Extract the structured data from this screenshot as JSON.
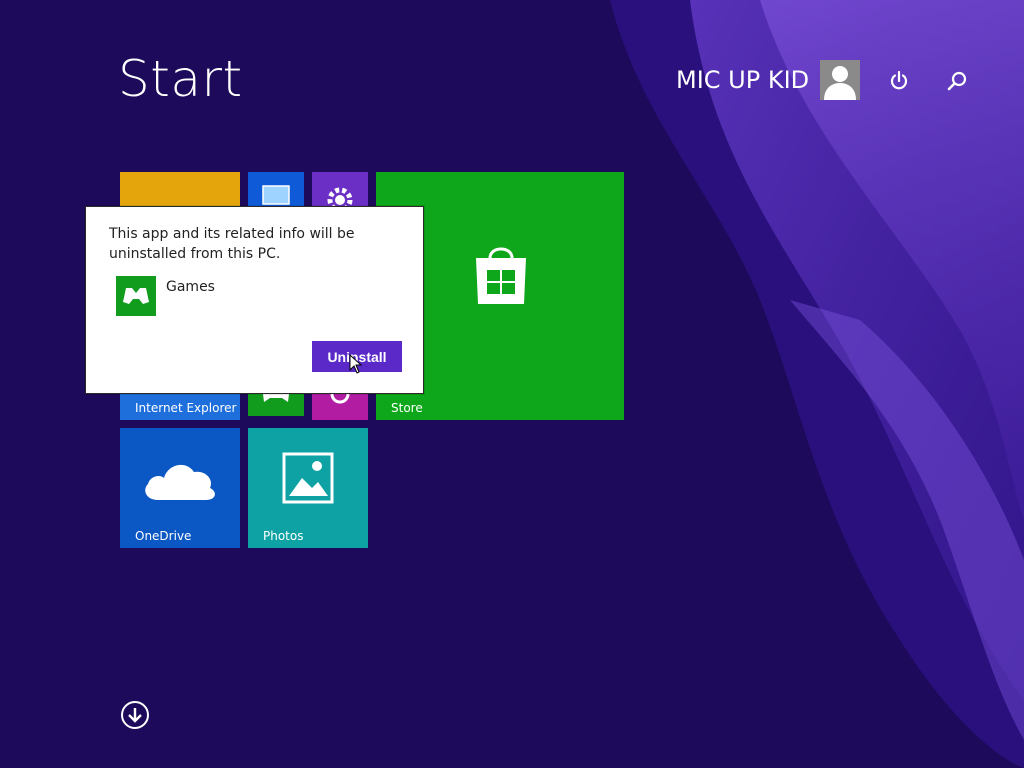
{
  "screen": {
    "title": "Start"
  },
  "header": {
    "user_name": "MIC UP KID",
    "icons": [
      "power-icon",
      "search-icon"
    ]
  },
  "tiles": {
    "internet_explorer": {
      "label": "Internet Explorer",
      "color": "#1e6fdc"
    },
    "store": {
      "label": "Store",
      "color": "#0ea61a"
    },
    "onedrive": {
      "label": "OneDrive",
      "color": "#0b57c4"
    },
    "photos": {
      "label": "Photos",
      "color": "#0fa2a5"
    },
    "partial_tiles": [
      {
        "name": "yellow-tile",
        "color": "#e3a50b"
      },
      {
        "name": "desktop-tile",
        "color": "#0f5bd7"
      },
      {
        "name": "settings-tile",
        "color": "#6b2fc6"
      },
      {
        "name": "games-tile",
        "color": "#119c1d"
      },
      {
        "name": "camera-tile",
        "color": "#b21ca3"
      }
    ]
  },
  "dialog": {
    "message": "This app and its related info will be uninstalled from this PC.",
    "app_name": "Games",
    "uninstall_label": "Uninstall"
  },
  "colors": {
    "background": "#1d0a5a",
    "accent": "#5b29c7"
  }
}
